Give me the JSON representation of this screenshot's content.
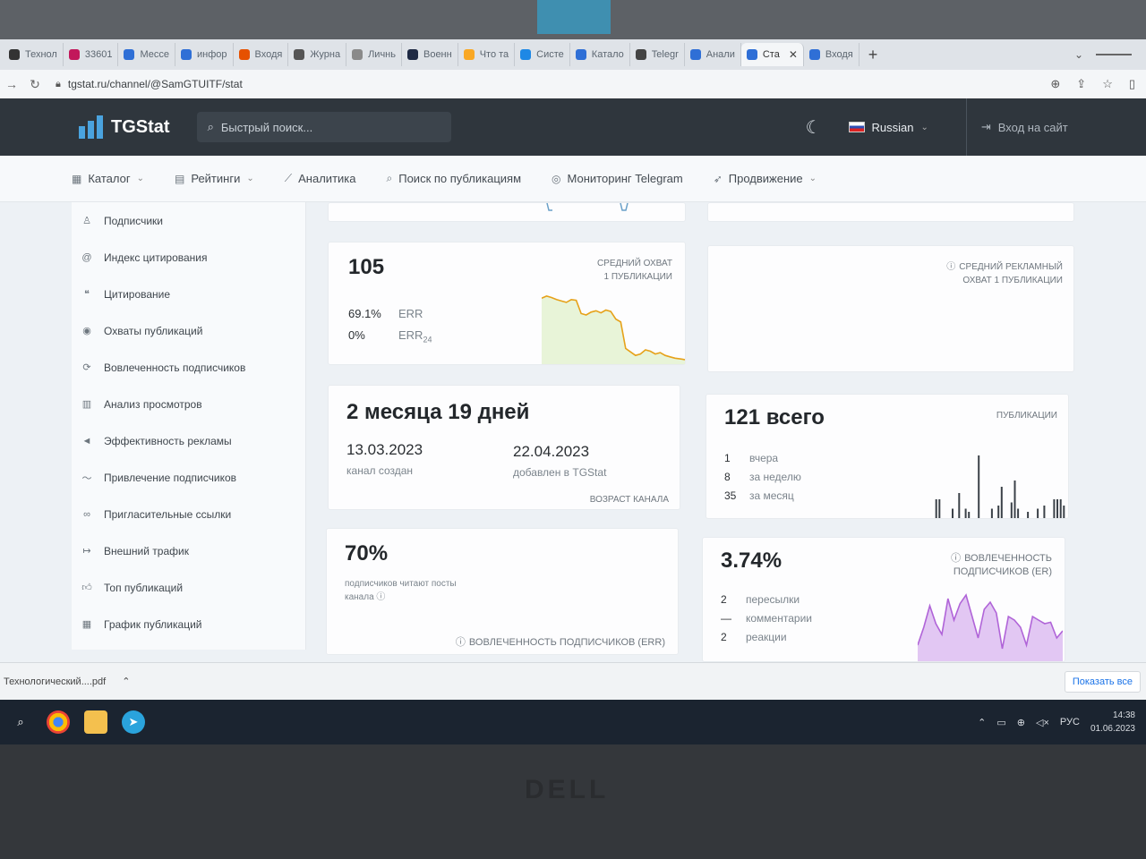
{
  "browser": {
    "tabs": [
      {
        "label": "Технол",
        "color": "#333333"
      },
      {
        "label": "33601",
        "color": "#c2185b"
      },
      {
        "label": "Мессе",
        "color": "#2f6fd6"
      },
      {
        "label": "инфор",
        "color": "#2f6fd6"
      },
      {
        "label": "Входя",
        "color": "#e65100"
      },
      {
        "label": "Журна",
        "color": "#555555"
      },
      {
        "label": "Личнь",
        "color": "#8a8a8a"
      },
      {
        "label": "Военн",
        "color": "#1f2a44"
      },
      {
        "label": "Что та",
        "color": "#f9a825"
      },
      {
        "label": "Систе",
        "color": "#1e88e5"
      },
      {
        "label": "Катало",
        "color": "#2f6fd6"
      },
      {
        "label": "Telegr",
        "color": "#444444"
      },
      {
        "label": "Анали",
        "color": "#2f6fd6"
      },
      {
        "label": "Ста",
        "color": "#2f6fd6",
        "active": true
      },
      {
        "label": "Входя",
        "color": "#2f6fd6"
      }
    ],
    "url": "tgstat.ru/channel/@SamGTUITF/stat"
  },
  "header": {
    "logo": "TGStat",
    "search_placeholder": "Быстрый поиск...",
    "language": "Russian",
    "login": "Вход на сайт"
  },
  "nav": {
    "items": [
      {
        "label": "Каталог",
        "icon": "grid-icon",
        "dropdown": true
      },
      {
        "label": "Рейтинги",
        "icon": "rating-icon",
        "dropdown": true
      },
      {
        "label": "Аналитика",
        "icon": "analytics-icon",
        "dropdown": false
      },
      {
        "label": "Поиск по публикациям",
        "icon": "search-icon",
        "dropdown": false
      },
      {
        "label": "Мониторинг Telegram",
        "icon": "monitor-icon",
        "dropdown": false
      },
      {
        "label": "Продвижение",
        "icon": "rocket-icon",
        "dropdown": true
      }
    ]
  },
  "sidebar": {
    "items": [
      {
        "label": "Подписчики",
        "icon": "users-icon"
      },
      {
        "label": "Индекс цитирования",
        "icon": "at-icon"
      },
      {
        "label": "Цитирование",
        "icon": "quote-icon"
      },
      {
        "label": "Охваты публикаций",
        "icon": "eye-icon"
      },
      {
        "label": "Вовлеченность подписчиков",
        "icon": "engagement-icon"
      },
      {
        "label": "Анализ просмотров",
        "icon": "bar-chart-icon"
      },
      {
        "label": "Эффективность рекламы",
        "icon": "megaphone-icon"
      },
      {
        "label": "Привлечение подписчиков",
        "icon": "trend-icon"
      },
      {
        "label": "Пригласительные ссылки",
        "icon": "link-icon"
      },
      {
        "label": "Внешний трафик",
        "icon": "arrow-icon"
      },
      {
        "label": "Топ публикаций",
        "icon": "thumbs-up-icon"
      },
      {
        "label": "График публикаций",
        "icon": "calendar-icon"
      }
    ]
  },
  "cards": {
    "reach": {
      "value": "105",
      "label_line1": "СРЕДНИЙ ОХВАТ",
      "label_line2": "1 ПУБЛИКАЦИИ",
      "err_value": "69.1%",
      "err_label": "ERR",
      "err24_value": "0%",
      "err24_label": "ERR",
      "err24_sub": "24",
      "series": [
        0.92,
        0.95,
        0.93,
        0.9,
        0.88,
        0.86,
        0.9,
        0.89,
        0.7,
        0.68,
        0.72,
        0.74,
        0.71,
        0.75,
        0.73,
        0.62,
        0.58,
        0.2,
        0.15,
        0.1,
        0.12,
        0.18,
        0.16,
        0.12,
        0.14,
        0.1,
        0.08,
        0.06,
        0.05,
        0.04
      ]
    },
    "ad_reach": {
      "label_line1": "СРЕДНИЙ РЕКЛАМНЫЙ",
      "label_line2": "ОХВАТ 1 ПУБЛИКАЦИИ"
    },
    "age": {
      "value": "2 месяца 19 дней",
      "created_date": "13.03.2023",
      "created_label": "канал создан",
      "added_date": "22.04.2023",
      "added_label": "добавлен в TGStat",
      "caption": "ВОЗРАСТ КАНАЛА"
    },
    "posts": {
      "value": "121 всего",
      "caption": "ПУБЛИКАЦИИ",
      "rows": [
        {
          "num": "1",
          "label": "вчера"
        },
        {
          "num": "8",
          "label": "за неделю"
        },
        {
          "num": "35",
          "label": "за месяц"
        }
      ],
      "bars": [
        0,
        0.3,
        0.3,
        0,
        0,
        0,
        0.15,
        0,
        0.4,
        0,
        0.15,
        0.1,
        0,
        0,
        1.0,
        0,
        0,
        0,
        0.15,
        0,
        0.2,
        0.5,
        0,
        0,
        0.25,
        0.6,
        0.15,
        0,
        0,
        0.1,
        0,
        0,
        0.15,
        0,
        0.2,
        0,
        0,
        0.3,
        0.3,
        0.3,
        0.2
      ]
    },
    "readers": {
      "value": "70%",
      "desc_line1": "подписчиков читают посты",
      "desc_line2": "канала",
      "caption": "ВОВЛЕЧЕННОСТЬ ПОДПИСЧИКОВ (ERR)"
    },
    "er": {
      "value": "3.74%",
      "caption_line1": "ВОВЛЕЧЕННОСТЬ",
      "caption_line2": "ПОДПИСЧИКОВ (ER)",
      "rows": [
        {
          "num": "2",
          "label": "пересылки"
        },
        {
          "num": "—",
          "label": "комментарии"
        },
        {
          "num": "2",
          "label": "реакции"
        }
      ],
      "series": [
        0.2,
        0.45,
        0.75,
        0.5,
        0.35,
        0.85,
        0.55,
        0.78,
        0.9,
        0.6,
        0.3,
        0.7,
        0.8,
        0.65,
        0.15,
        0.6,
        0.55,
        0.45,
        0.2,
        0.6,
        0.55,
        0.5,
        0.52,
        0.3,
        0.4
      ]
    }
  },
  "downloads": {
    "file": "Технологический....pdf",
    "show_all": "Показать все"
  },
  "taskbar": {
    "lang": "РУС",
    "time": "14:38",
    "date": "01.06.2023"
  },
  "colors": {
    "reach_line": "#e6a21a",
    "reach_fill": "#e8f4d8",
    "er_line": "#b064d8",
    "er_fill": "#e2c7f3",
    "bars": "#3b4148",
    "header_bg": "#2f363d"
  }
}
